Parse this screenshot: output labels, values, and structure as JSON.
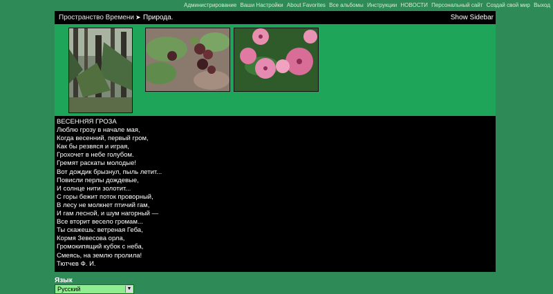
{
  "topnav": {
    "links": [
      "Администрирование",
      "Ваши Настройки",
      "About Favorites",
      "Все альбомы",
      "Инструкции",
      "НОВОСТИ",
      "Персональный сайт",
      "Создай свой мир",
      "Выход"
    ]
  },
  "breadcrumb": {
    "home": "Пространство Времени",
    "separator": "➤",
    "current": "Природа."
  },
  "sidebar_toggle": "Show Sidebar",
  "gallery": {
    "thumbnails": [
      {
        "subject": "forest"
      },
      {
        "subject": "berries"
      },
      {
        "subject": "pink-flowers"
      }
    ]
  },
  "poem": {
    "lines": [
      "ВЕСЕННЯЯ ГРОЗА",
      "Люблю грозу в начале мая,",
      "Когда весенний, первый гром,",
      "Как бы резвяся и играя,",
      "Грохочет в небе голубом.",
      "Гремят раскаты молодые!",
      "Вот дождик брызнул, пыль летит...",
      "Повисли перлы дождевые,",
      "И солнце нити золотит...",
      "С горы бежит поток проворный,",
      "В лесу не молкнет птичий гам,",
      "И гам лесной, и шум нагорный —",
      "Все вторит весело громам...",
      "Ты скажешь: ветреная Геба,",
      "Кормя Зевесова орла,",
      "Громокипящий кубок с неба,",
      "Смеясь, на землю пролила!",
      "Тютчев Ф. И."
    ]
  },
  "language": {
    "label": "Язык",
    "selected": "Русский"
  },
  "colors": {
    "page_background": "#2e8b57",
    "gallery_background": "#1fa55a",
    "content_background": "#000000",
    "select_background": "#90ee90"
  }
}
